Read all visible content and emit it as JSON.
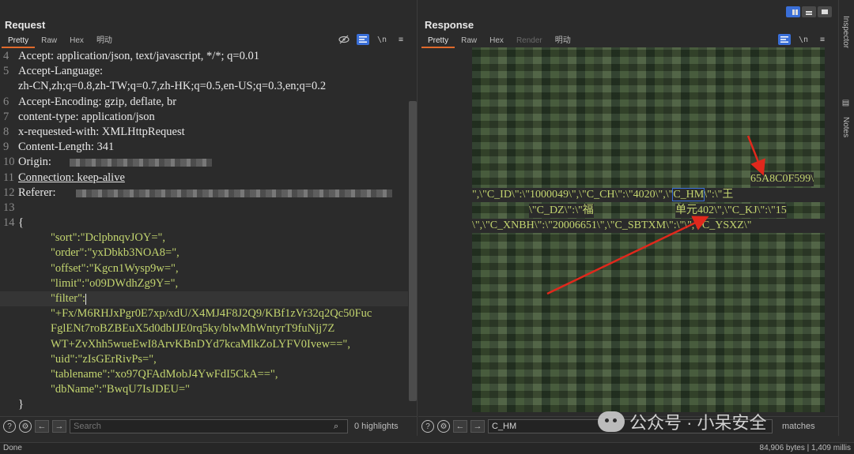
{
  "request": {
    "title": "Request",
    "tabs": [
      "Pretty",
      "Raw",
      "Hex",
      "明动"
    ],
    "tools": {
      "wrap": "\\n",
      "menu": "≡"
    },
    "lines": [
      {
        "n": "4",
        "text": "Accept: application/json, text/javascript, */*; q=0.01"
      },
      {
        "n": "5",
        "text": "Accept-Language:"
      },
      {
        "n": "",
        "text": "zh-CN,zh;q=0.8,zh-TW;q=0.7,zh-HK;q=0.5,en-US;q=0.3,en;q=0.2"
      },
      {
        "n": "6",
        "text": "Accept-Encoding: gzip, deflate, br"
      },
      {
        "n": "7",
        "text": "content-type: application/json"
      },
      {
        "n": "8",
        "text": "x-requested-with: XMLHttpRequest"
      },
      {
        "n": "9",
        "text": "Content-Length: 341"
      },
      {
        "n": "10",
        "text": "Origin:"
      },
      {
        "n": "11",
        "text": "Connection: keep-alive"
      },
      {
        "n": "12",
        "text": "Referer:"
      },
      {
        "n": "13",
        "text": ""
      },
      {
        "n": "14",
        "text": "{"
      }
    ],
    "body": [
      {
        "key": "\"sort\":",
        "val": "\"DclpbnqvJOY=\","
      },
      {
        "key": "\"order\":",
        "val": "\"yxDbkb3NOA8=\","
      },
      {
        "key": "\"offset\":",
        "val": "\"Kgcn1Wysp9w=\","
      },
      {
        "key": "\"limit\":",
        "val": "\"o09DWdhZg9Y=\","
      },
      {
        "key": "\"filter\":",
        "val": ""
      },
      {
        "key": "",
        "val": "\"+Fx/M6RHJxPgr0E7xp/xdU/X4MJ4F8J2Q9/KBf1zVr32q2Qc50Fuc"
      },
      {
        "key": "",
        "val": "FglENt7roBZBEuX5d0dbIJE0rq5ky/blwMhWntyrT9fuNjj7Z"
      },
      {
        "key": "",
        "val": "WT+ZvXhh5wueEwI8ArvKBnDYd7kcaMlkZoLYFV0Ivew==\","
      },
      {
        "key": "\"uid\":",
        "val": "\"zIsGErRivPs=\","
      },
      {
        "key": "\"tablename\":",
        "val": "\"xo97QFAdMobJ4YwFdI5CkA==\","
      },
      {
        "key": "\"dbName\":",
        "val": "\"BwqU7IsJDEU=\""
      }
    ],
    "closing": "}",
    "search_placeholder": "Search",
    "highlights": "0 highlights"
  },
  "response": {
    "title": "Response",
    "tabs": [
      "Pretty",
      "Raw",
      "Hex",
      "Render",
      "明动"
    ],
    "tools": {
      "wrap": "\\n",
      "menu": "≡"
    },
    "visible_lines": [
      "65A8C0F599\\",
      "\",\\\"C_ID\\\":\\\"1000049\\\",\\\"C_CH\\\":\\\"4020\\\",\\\"C_HM\\\":\\\"王",
      "\\\"C_DZ\\\":\\\"福",
      "单元402\\\",\\\"C_KJ\\\":\\\"15",
      "\\\",\\\"C_XNBH\\\":\\\"20006651\\\",\\\"C_SBTXM\\\":\\\"\\\",\\\"C_YSXZ\\\""
    ],
    "highlighted_term": "C_HM",
    "search_value": "C_HM",
    "matches": "matches"
  },
  "side_rail": {
    "inspector": "Inspector",
    "notes": "Notes"
  },
  "status": {
    "left": "Done",
    "right": "84,906 bytes | 1,409 millis"
  },
  "watermark": "公众号 · 小呆安全",
  "colors": {
    "accent_tab": "#e06a2c",
    "accent_blue": "#3a6fd8",
    "json_green": "#c3d56f",
    "arrow_red": "#e0281c"
  }
}
